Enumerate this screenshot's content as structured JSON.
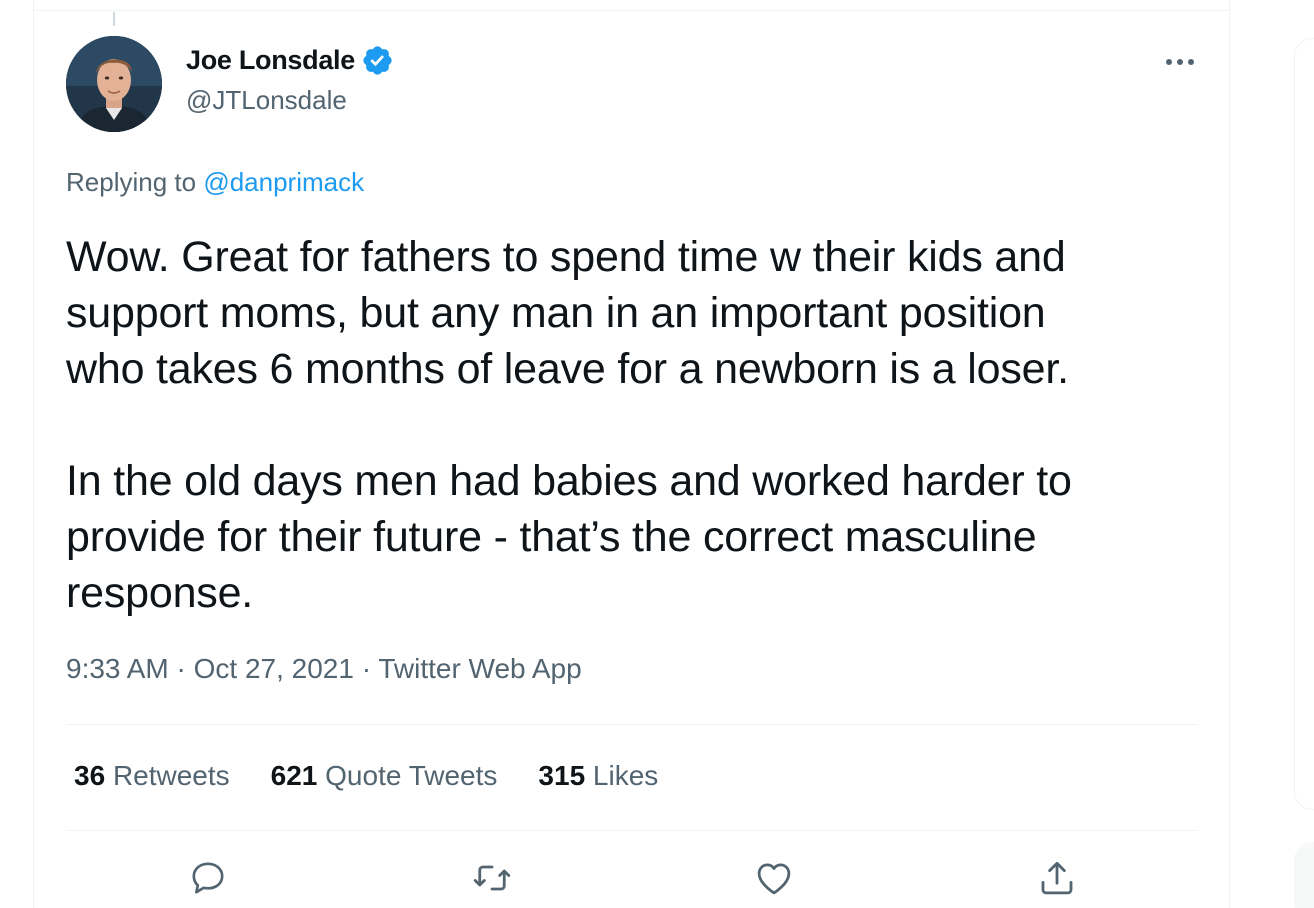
{
  "tweet": {
    "author": {
      "display_name": "Joe Lonsdale",
      "handle": "@JTLonsdale",
      "verified_icon": "verified-badge-icon"
    },
    "replying_to_prefix": "Replying to",
    "replying_to_handle": "@danprimack",
    "paragraphs": [
      "Wow.  Great for fathers to spend time w their kids and\nsupport moms, but any man in an important position\nwho takes 6 months of leave for a newborn is a loser.",
      "In the old days men had babies and worked harder to\nprovide for their future - that’s the correct masculine\nresponse."
    ],
    "meta": "9:33 AM · Oct 27, 2021 · Twitter Web App",
    "stats": [
      {
        "count": "36",
        "label": "Retweets"
      },
      {
        "count": "621",
        "label": "Quote Tweets"
      },
      {
        "count": "315",
        "label": "Likes"
      }
    ],
    "actions": [
      {
        "icon": "reply-icon"
      },
      {
        "icon": "retweet-icon"
      },
      {
        "icon": "like-icon"
      },
      {
        "icon": "share-icon"
      }
    ],
    "more_icon": "more-options-icon"
  },
  "colors": {
    "accent": "#1d9bf0",
    "text_primary": "#0f1419",
    "text_secondary": "#536471",
    "divider": "#eff3f4"
  }
}
